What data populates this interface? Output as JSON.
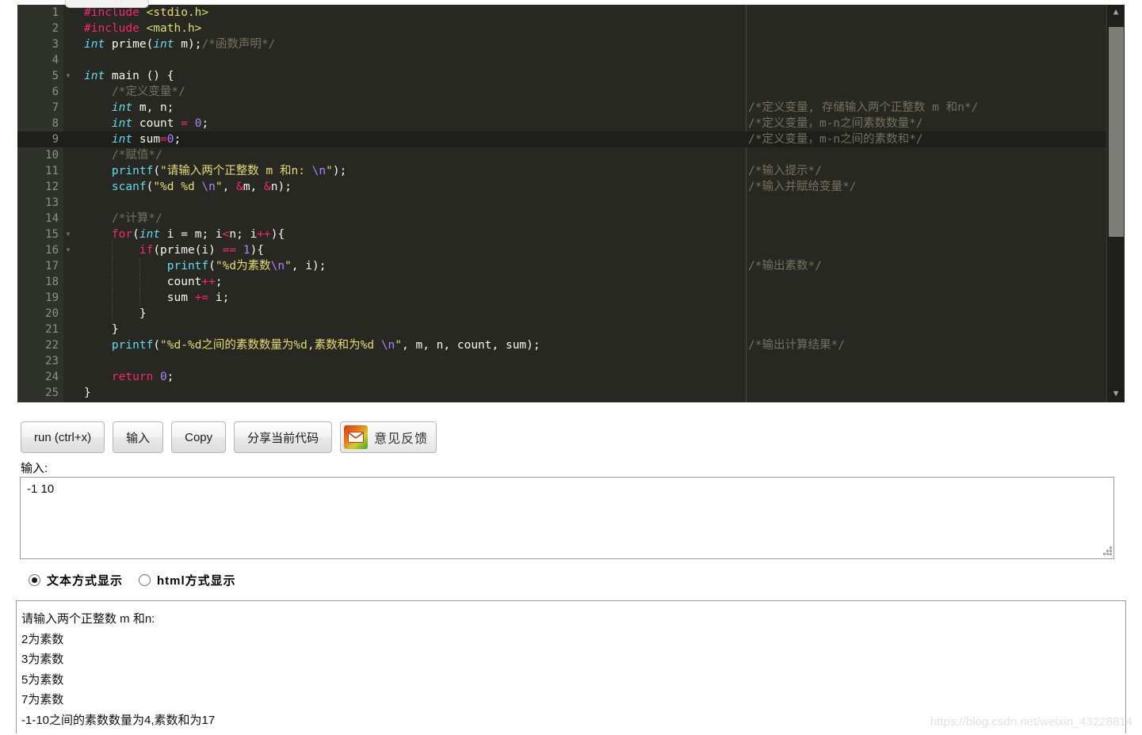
{
  "editor": {
    "total_lines": 25,
    "active_line": 9,
    "fold_lines": [
      5,
      15,
      16
    ],
    "lines": [
      {
        "n": 1,
        "indent": 0,
        "tokens": [
          {
            "c": "pre",
            "t": "#include"
          },
          {
            "c": "id",
            "t": " "
          },
          {
            "c": "inc",
            "t": "<stdio.h>"
          }
        ]
      },
      {
        "n": 2,
        "indent": 0,
        "tokens": [
          {
            "c": "pre",
            "t": "#include"
          },
          {
            "c": "id",
            "t": " "
          },
          {
            "c": "inc",
            "t": "<math.h>"
          }
        ]
      },
      {
        "n": 3,
        "indent": 0,
        "tokens": [
          {
            "c": "kw",
            "t": "int"
          },
          {
            "c": "id",
            "t": " prime("
          },
          {
            "c": "kw",
            "t": "int"
          },
          {
            "c": "id",
            "t": " m);"
          },
          {
            "c": "cmt",
            "t": "/*函数声明*/"
          }
        ]
      },
      {
        "n": 4,
        "indent": 0,
        "tokens": []
      },
      {
        "n": 5,
        "indent": 0,
        "tokens": [
          {
            "c": "kw",
            "t": "int"
          },
          {
            "c": "id",
            "t": " main () {"
          }
        ]
      },
      {
        "n": 6,
        "indent": 1,
        "tokens": [
          {
            "c": "cmt",
            "t": "    /*定义变量*/"
          }
        ]
      },
      {
        "n": 7,
        "indent": 1,
        "tokens": [
          {
            "c": "id",
            "t": "    "
          },
          {
            "c": "kw",
            "t": "int"
          },
          {
            "c": "id",
            "t": " m, n;"
          }
        ]
      },
      {
        "n": 8,
        "indent": 1,
        "tokens": [
          {
            "c": "id",
            "t": "    "
          },
          {
            "c": "kw",
            "t": "int"
          },
          {
            "c": "id",
            "t": " count "
          },
          {
            "c": "op",
            "t": "="
          },
          {
            "c": "id",
            "t": " "
          },
          {
            "c": "num",
            "t": "0"
          },
          {
            "c": "id",
            "t": ";"
          }
        ]
      },
      {
        "n": 9,
        "indent": 1,
        "tokens": [
          {
            "c": "id",
            "t": "    "
          },
          {
            "c": "kw",
            "t": "int"
          },
          {
            "c": "id",
            "t": " sum"
          },
          {
            "c": "op",
            "t": "="
          },
          {
            "c": "num",
            "t": "0"
          },
          {
            "c": "id",
            "t": ";"
          }
        ]
      },
      {
        "n": 10,
        "indent": 1,
        "tokens": [
          {
            "c": "cmt",
            "t": "    /*赋值*/"
          }
        ]
      },
      {
        "n": 11,
        "indent": 1,
        "tokens": [
          {
            "c": "id",
            "t": "    "
          },
          {
            "c": "fn",
            "t": "printf"
          },
          {
            "c": "id",
            "t": "("
          },
          {
            "c": "str",
            "t": "\"请输入两个正整数 m 和n: "
          },
          {
            "c": "esc",
            "t": "\\n"
          },
          {
            "c": "str",
            "t": "\""
          },
          {
            "c": "id",
            "t": ");"
          }
        ]
      },
      {
        "n": 12,
        "indent": 1,
        "tokens": [
          {
            "c": "id",
            "t": "    "
          },
          {
            "c": "fn",
            "t": "scanf"
          },
          {
            "c": "id",
            "t": "("
          },
          {
            "c": "str",
            "t": "\"%d %d "
          },
          {
            "c": "esc",
            "t": "\\n"
          },
          {
            "c": "str",
            "t": "\""
          },
          {
            "c": "id",
            "t": ", "
          },
          {
            "c": "op",
            "t": "&"
          },
          {
            "c": "id",
            "t": "m, "
          },
          {
            "c": "op",
            "t": "&"
          },
          {
            "c": "id",
            "t": "n);"
          }
        ]
      },
      {
        "n": 13,
        "indent": 1,
        "tokens": []
      },
      {
        "n": 14,
        "indent": 1,
        "tokens": [
          {
            "c": "cmt",
            "t": "    /*计算*/"
          }
        ]
      },
      {
        "n": 15,
        "indent": 1,
        "tokens": [
          {
            "c": "id",
            "t": "    "
          },
          {
            "c": "kw2",
            "t": "for"
          },
          {
            "c": "id",
            "t": "("
          },
          {
            "c": "kw",
            "t": "int"
          },
          {
            "c": "id",
            "t": " i = m; i"
          },
          {
            "c": "op",
            "t": "<"
          },
          {
            "c": "id",
            "t": "n; i"
          },
          {
            "c": "op",
            "t": "++"
          },
          {
            "c": "id",
            "t": "){"
          }
        ]
      },
      {
        "n": 16,
        "indent": 2,
        "tokens": [
          {
            "c": "id",
            "t": "        "
          },
          {
            "c": "kw2",
            "t": "if"
          },
          {
            "c": "id",
            "t": "(prime(i) "
          },
          {
            "c": "op",
            "t": "=="
          },
          {
            "c": "id",
            "t": " "
          },
          {
            "c": "num",
            "t": "1"
          },
          {
            "c": "id",
            "t": "){"
          }
        ]
      },
      {
        "n": 17,
        "indent": 3,
        "tokens": [
          {
            "c": "id",
            "t": "            "
          },
          {
            "c": "fn",
            "t": "printf"
          },
          {
            "c": "id",
            "t": "("
          },
          {
            "c": "str",
            "t": "\"%d为素数"
          },
          {
            "c": "esc",
            "t": "\\n"
          },
          {
            "c": "str",
            "t": "\""
          },
          {
            "c": "id",
            "t": ", i);"
          }
        ]
      },
      {
        "n": 18,
        "indent": 3,
        "tokens": [
          {
            "c": "id",
            "t": "            count"
          },
          {
            "c": "op",
            "t": "++"
          },
          {
            "c": "id",
            "t": ";"
          }
        ]
      },
      {
        "n": 19,
        "indent": 3,
        "tokens": [
          {
            "c": "id",
            "t": "            sum "
          },
          {
            "c": "op",
            "t": "+="
          },
          {
            "c": "id",
            "t": " i;"
          }
        ]
      },
      {
        "n": 20,
        "indent": 2,
        "tokens": [
          {
            "c": "id",
            "t": "        }"
          }
        ]
      },
      {
        "n": 21,
        "indent": 1,
        "tokens": [
          {
            "c": "id",
            "t": "    }"
          }
        ]
      },
      {
        "n": 22,
        "indent": 1,
        "tokens": [
          {
            "c": "id",
            "t": "    "
          },
          {
            "c": "fn",
            "t": "printf"
          },
          {
            "c": "id",
            "t": "("
          },
          {
            "c": "str",
            "t": "\"%d-%d之间的素数数量为%d,素数和为%d "
          },
          {
            "c": "esc",
            "t": "\\n"
          },
          {
            "c": "str",
            "t": "\""
          },
          {
            "c": "id",
            "t": ", m, n, count, sum);"
          }
        ]
      },
      {
        "n": 23,
        "indent": 1,
        "tokens": []
      },
      {
        "n": 24,
        "indent": 1,
        "tokens": [
          {
            "c": "id",
            "t": "    "
          },
          {
            "c": "kw2",
            "t": "return"
          },
          {
            "c": "id",
            "t": " "
          },
          {
            "c": "num",
            "t": "0"
          },
          {
            "c": "id",
            "t": ";"
          }
        ]
      },
      {
        "n": 25,
        "indent": 0,
        "tokens": [
          {
            "c": "id",
            "t": "}"
          }
        ]
      }
    ],
    "right_comments": [
      {
        "n": 7,
        "text": "/*定义变量, 存储输入两个正整数 m 和n*/"
      },
      {
        "n": 8,
        "text": "/*定义变量，m-n之间素数数量*/"
      },
      {
        "n": 9,
        "text": "/*定义变量，m-n之间的素数和*/"
      },
      {
        "n": 11,
        "text": "/*输入提示*/"
      },
      {
        "n": 12,
        "text": "/*输入并赋给变量*/"
      },
      {
        "n": 17,
        "text": "/*输出素数*/"
      },
      {
        "n": 22,
        "text": "/*输出计算结果*/"
      }
    ],
    "colors": {
      "background": "#272822",
      "gutter": "#2f312b",
      "active_line": "#1e1f1a",
      "keyword": "#66d9ef",
      "control": "#f92672",
      "string": "#e6db74",
      "comment": "#75715e",
      "number": "#ae81ff",
      "text": "#f8f8f2"
    },
    "scrollbar": {
      "up_arrow": "⌃",
      "down_arrow": "⌄"
    }
  },
  "toolbar": {
    "run_label": "run (ctrl+x)",
    "input_label": "输入",
    "copy_label": "Copy",
    "share_label": "分享当前代码",
    "feedback_label": "意见反馈"
  },
  "input_section": {
    "label": "输入:",
    "value": "-1 10",
    "placeholder": ""
  },
  "display_mode": {
    "options": [
      {
        "label": "文本方式显示",
        "checked": true
      },
      {
        "label": "html方式显示",
        "checked": false
      }
    ]
  },
  "output": {
    "lines": [
      "请输入两个正整数 m 和n:",
      "2为素数",
      "3为素数",
      "5为素数",
      "7为素数",
      "-1-10之间的素数数量为4,素数和为17"
    ]
  },
  "watermark": "https://blog.csdn.net/weixin_43228814"
}
